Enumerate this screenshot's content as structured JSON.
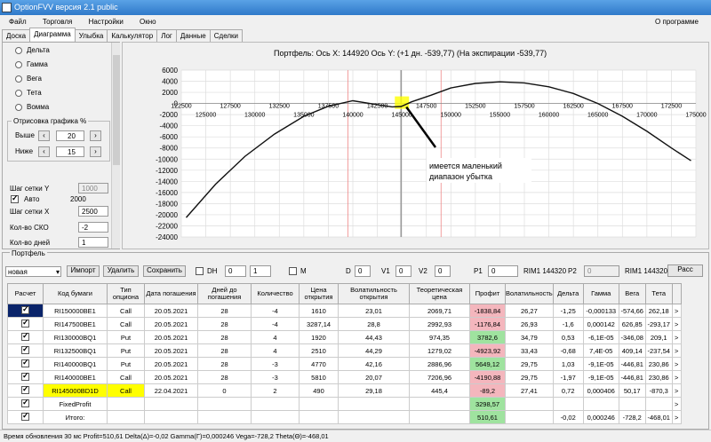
{
  "window": {
    "title": "OptionFVV версия 2.1 public"
  },
  "menu": {
    "file": "Файл",
    "trade": "Торговля",
    "settings": "Настройки",
    "window": "Окно",
    "about": "О программе"
  },
  "tabs": [
    "Доска",
    "Диаграмма",
    "Улыбка",
    "Калькулятор",
    "Лог",
    "Данные",
    "Сделки"
  ],
  "left": {
    "radios": [
      "Дельта",
      "Гамма",
      "Вега",
      "Тета",
      "Вомма"
    ],
    "group_title": "Отрисовка графика %",
    "above_label": "Выше",
    "above_value": "20",
    "below_label": "Ниже",
    "below_value": "15",
    "grid_y_label": "Шаг сетки Y",
    "grid_y_value": "1000",
    "auto_label": "Авто",
    "auto_value": "2000",
    "grid_x_label": "Шаг сетки X",
    "grid_x_value": "2500",
    "sko_label": "Кол-во СКО",
    "sko_value": "-2",
    "days_label": "Кол-во дней",
    "days_value": "1"
  },
  "chart": {
    "title": "Портфель:  Ось X:  144920  Ось  Y:   (+1 дн.  -539,77)   (На экспирации -539,77)",
    "callout": "имеется маленький диапазон убытка"
  },
  "chart_data": {
    "type": "line",
    "x_top_ticks": [
      "122500",
      "127500",
      "132500",
      "137500",
      "142500",
      "147500",
      "152500",
      "157500",
      "162500",
      "167500",
      "172500"
    ],
    "x_bottom_ticks": [
      "125000",
      "130000",
      "135000",
      "140000",
      "145000",
      "150000",
      "155000",
      "160000",
      "165000",
      "170000",
      "175000"
    ],
    "y_ticks": [
      "6000",
      "4000",
      "2000",
      "0",
      "-2000",
      "-4000",
      "-6000",
      "-8000",
      "-10000",
      "-12000",
      "-14000",
      "-16000",
      "-18000",
      "-20000",
      "-22000",
      "-24000"
    ],
    "ylim": [
      -24000,
      6000
    ],
    "xlim": [
      122500,
      175000
    ],
    "series": [
      {
        "x": [
          123000,
          126000,
          129000,
          132000,
          135000,
          137500,
          140000,
          142500,
          144000,
          144920,
          146000,
          148000,
          150000,
          152500,
          155000,
          157500,
          160000,
          162500,
          165000,
          167500,
          170000,
          172500,
          174500
        ],
        "y": [
          -20500,
          -14500,
          -9500,
          -5500,
          -2300,
          -500,
          500,
          -200,
          -600,
          -540,
          300,
          1500,
          2800,
          3600,
          3900,
          3700,
          3000,
          1800,
          0,
          -2300,
          -5000,
          -8000,
          -10300
        ]
      }
    ],
    "marker_x": 144920
  },
  "portfolio": {
    "title": "Портфель",
    "select": "новая",
    "import": "Импорт",
    "delete": "Удалить",
    "save": "Сохранить",
    "dh_label": "DH",
    "dh1": "0",
    "dh2": "1",
    "m_label": "M",
    "d_label": "D",
    "d_value": "0",
    "v1_label": "V1",
    "v1_value": "0",
    "v2_label": "V2",
    "v2_value": "0",
    "p1_label": "P1",
    "p1_value": "0",
    "rim1": "RIM1 144320",
    "p2_label": "P2",
    "p2_value": "0",
    "rim2": "RIM1 144320",
    "calc": "Расс"
  },
  "table": {
    "headers": [
      "Расчет",
      "Код бумаги",
      "Тип опциона",
      "Дата погашения",
      "Дней до погашения",
      "Количество",
      "Цена открытия",
      "Волатильность открытия",
      "Теоретическая цена",
      "Профит",
      "Волатильность",
      "Дельта",
      "Гамма",
      "Вега",
      "Тета"
    ],
    "rows": [
      [
        "RI150000BE1",
        "Call",
        "20.05.2021",
        "28",
        "-4",
        "1610",
        "23,01",
        "2069,71",
        "-1838,84",
        "26,27",
        "-1,25",
        "-0,000133",
        "-574,66",
        "262,18"
      ],
      [
        "RI147500BE1",
        "Call",
        "20.05.2021",
        "28",
        "-4",
        "3287,14",
        "28,8",
        "2992,93",
        "-1176,84",
        "26,93",
        "-1,6",
        "0,000142",
        "626,85",
        "-293,17"
      ],
      [
        "RI130000BQ1",
        "Put",
        "20.05.2021",
        "28",
        "4",
        "1920",
        "44,43",
        "974,35",
        "3782,6",
        "34,79",
        "0,53",
        "-6,1E-05",
        "-346,08",
        "209,1"
      ],
      [
        "RI132500BQ1",
        "Put",
        "20.05.2021",
        "28",
        "4",
        "2510",
        "44,29",
        "1279,02",
        "-4923,92",
        "33,43",
        "-0,68",
        "7,4E-05",
        "409,14",
        "-237,54"
      ],
      [
        "RI140000BQ1",
        "Put",
        "20.05.2021",
        "28",
        "-3",
        "4770",
        "42,16",
        "2886,96",
        "5649,12",
        "29,75",
        "1,03",
        "-9,1E-05",
        "-446,81",
        "230,86"
      ],
      [
        "RI140000BE1",
        "Call",
        "20.05.2021",
        "28",
        "-3",
        "5810",
        "20,07",
        "7206,96",
        "-4190,88",
        "29,75",
        "-1,97",
        "-9,1E-05",
        "-446,81",
        "230,86"
      ],
      [
        "RI145000BD1D",
        "Call",
        "22.04.2021",
        "0",
        "2",
        "490",
        "29,18",
        "445,4",
        "-89,2",
        "27,41",
        "0,72",
        "0,000406",
        "50,17",
        "-870,3"
      ],
      [
        "FixedProfit",
        "",
        "",
        "",
        "",
        "",
        "",
        "",
        "3298,57",
        "",
        "",
        "",
        "",
        ""
      ],
      [
        "Итого:",
        "",
        "",
        "",
        "",
        "",
        "",
        "",
        "510,61",
        "",
        "-0,02",
        "0,000246",
        "-728,2",
        "-468,01"
      ]
    ],
    "profit_colors": [
      "red",
      "red",
      "green",
      "red",
      "green",
      "red",
      "red",
      "green",
      "green"
    ]
  },
  "status": "Время обновления 30 мс  Profit=510,61 Delta(Δ)=-0,02 Gamma(Γ)=0,000246 Vega=-728,2 Theta(Θ)=-468,01"
}
